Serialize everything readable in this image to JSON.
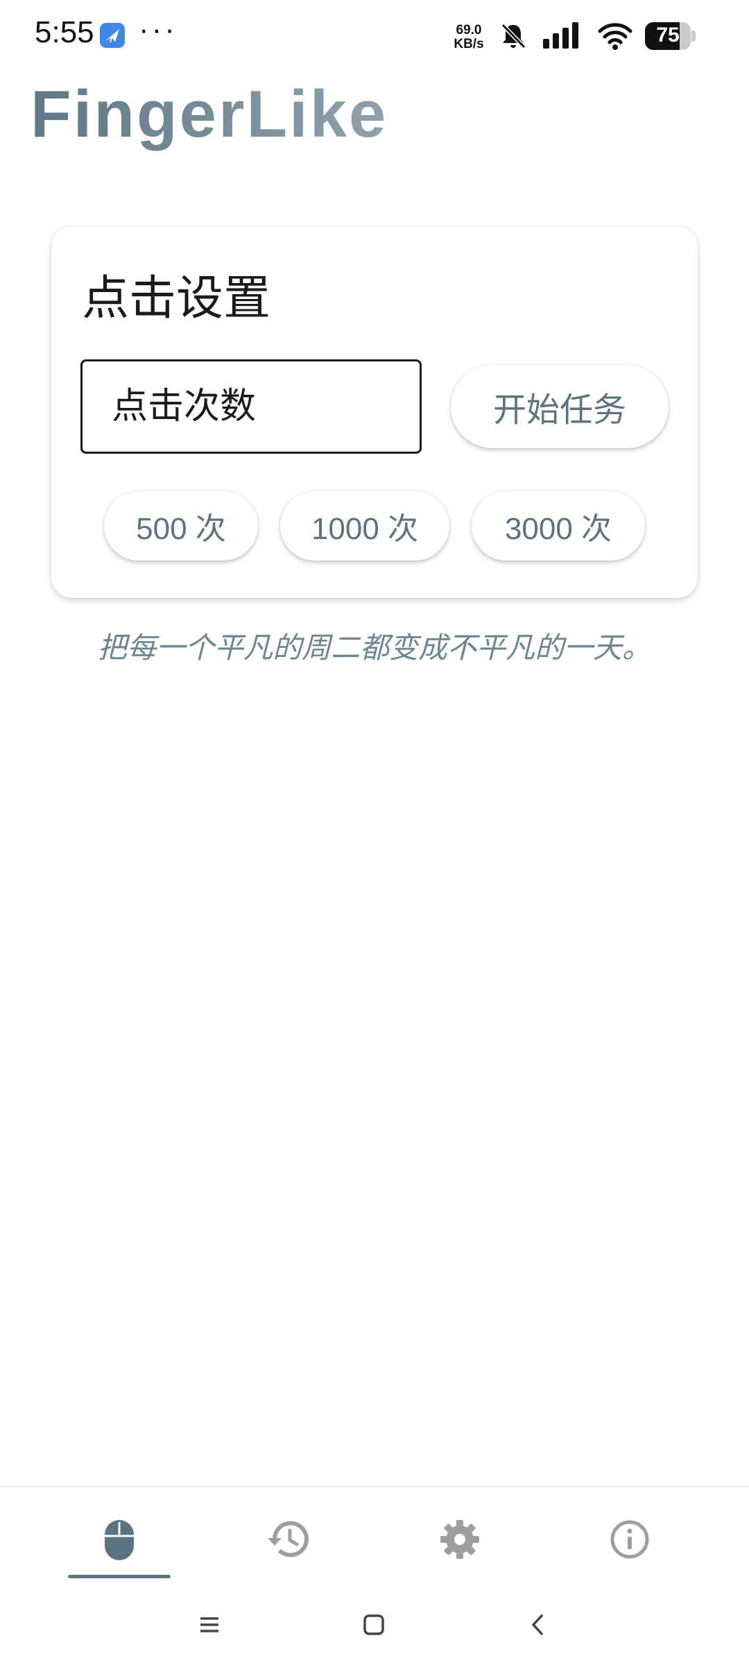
{
  "status_bar": {
    "time": "5:55",
    "app_icon": "kite-app-icon",
    "more": "···",
    "net_speed_value": "69.0",
    "net_speed_unit": "KB/s",
    "icons": [
      "bell-off-icon",
      "signal-icon",
      "wifi-icon"
    ],
    "battery_level": "75",
    "battery_fraction": 0.75
  },
  "app": {
    "title": "FingerLike",
    "title_gradient": [
      "#5f7886",
      "#8ea2ad"
    ],
    "accent_color": "#5b7482"
  },
  "card": {
    "title": "点击设置",
    "count_input": {
      "placeholder": "点击次数",
      "value": ""
    },
    "start_button": "开始任务",
    "presets": [
      "500 次",
      "1000 次",
      "3000 次"
    ]
  },
  "slogan": "把每一个平凡的周二都变成不平凡的一天。",
  "bottom_nav": {
    "items": [
      {
        "icon": "mouse-icon",
        "active": true
      },
      {
        "icon": "history-icon",
        "active": false
      },
      {
        "icon": "settings-gear-icon",
        "active": false
      },
      {
        "icon": "info-icon",
        "active": false
      }
    ],
    "active_color": "#5b7482",
    "inactive_color": "#9e9e9e"
  },
  "system_nav": {
    "buttons": [
      "menu-icon",
      "home-icon",
      "back-icon"
    ]
  }
}
